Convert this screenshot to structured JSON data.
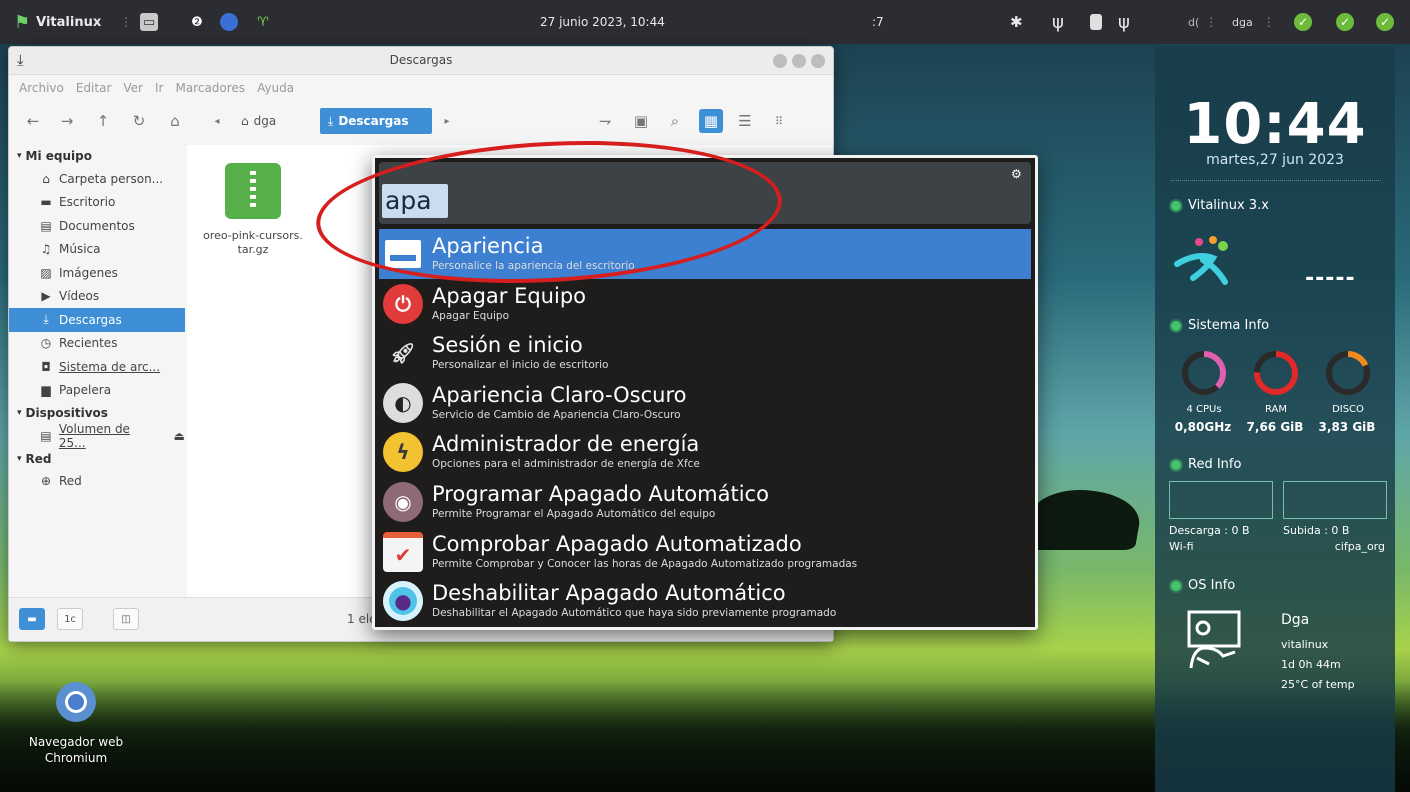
{
  "top_panel": {
    "app_name": "Vitalinux",
    "datetime": "27 junio 2023, 10:44",
    "workspace_hint": ":7",
    "user_label": "dga",
    "user_prefix": "d("
  },
  "file_manager": {
    "title": "Descargas",
    "menu": [
      "Archivo",
      "Editar",
      "Ver",
      "Ir",
      "Marcadores",
      "Ayuda"
    ],
    "breadcrumb": {
      "home": "dga",
      "current": "Descargas"
    },
    "sidebar": {
      "sections": [
        {
          "title": "Mi equipo",
          "items": [
            {
              "label": "Carpeta person...",
              "icon": "home-icon"
            },
            {
              "label": "Escritorio",
              "icon": "desktop-icon"
            },
            {
              "label": "Documentos",
              "icon": "document-icon"
            },
            {
              "label": "Música",
              "icon": "music-icon"
            },
            {
              "label": "Imágenes",
              "icon": "image-icon"
            },
            {
              "label": "Vídeos",
              "icon": "video-icon"
            },
            {
              "label": "Descargas",
              "icon": "download-icon",
              "selected": true
            },
            {
              "label": "Recientes",
              "icon": "clock-icon"
            },
            {
              "label": "Sistema de arc...",
              "icon": "drive-icon"
            },
            {
              "label": "Papelera",
              "icon": "trash-icon"
            }
          ]
        },
        {
          "title": "Dispositivos",
          "items": [
            {
              "label": "Volumen de 25...",
              "icon": "volume-icon"
            }
          ]
        },
        {
          "title": "Red",
          "items": [
            {
              "label": "Red",
              "icon": "network-icon"
            }
          ]
        }
      ]
    },
    "file": {
      "name": "oreo-pink-cursors.\ntar.gz"
    },
    "status_text": "1 ele"
  },
  "launcher": {
    "query": "apa",
    "results": [
      {
        "name": "Apariencia",
        "desc": "Personalice la apariencia del escritorio",
        "icon": "appearance-icon",
        "selected": true
      },
      {
        "name": "Apagar Equipo",
        "desc": "Apagar Equipo",
        "icon": "power-icon"
      },
      {
        "name": "Sesión e inicio",
        "desc": "Personalizar el inicio de escritorio",
        "icon": "rocket-icon"
      },
      {
        "name": "Apariencia Claro-Oscuro",
        "desc": "Servicio de Cambio de Apariencia Claro-Oscuro",
        "icon": "contrast-icon"
      },
      {
        "name": "Administrador de energía",
        "desc": "Opciones para el administrador de energía de Xfce",
        "icon": "energy-icon"
      },
      {
        "name": "Programar Apagado Automático",
        "desc": "Permite Programar el Apagado Automático del equipo",
        "icon": "shutdown-schedule-icon"
      },
      {
        "name": "Comprobar Apagado Automatizado",
        "desc": "Permite Comprobar y Conocer las horas de Apagado Automatizado programadas",
        "icon": "calendar-check-icon"
      },
      {
        "name": "Deshabilitar Apagado Automático",
        "desc": "Deshabilitar el Apagado Automático que haya sido previamente programado",
        "icon": "disable-target-icon"
      }
    ]
  },
  "conky": {
    "time": "10:44",
    "date": "martes,27 jun 2023",
    "distro": "Vitalinux 3.x",
    "dashes": "-----",
    "sistema_title": "Sistema Info",
    "cpu": {
      "label": "4 CPUs",
      "value": "0,80GHz"
    },
    "ram": {
      "label": "RAM",
      "value": "7,66 GiB"
    },
    "disk": {
      "label": "DISCO",
      "value": "3,83 GiB"
    },
    "red_title": "Red Info",
    "download": "Descarga : 0 B",
    "upload": "Subida : 0 B",
    "iface": "Wi-fi",
    "ssid": "cifpa_org",
    "os_title": "OS Info",
    "os_user": "Dga",
    "os_host": "vitalinux",
    "os_uptime": "1d 0h 44m",
    "os_temp": "25°C of temp"
  },
  "desktop": {
    "icon_label": "Navegador web Chromium"
  },
  "colors": {
    "accent": "#3d7fd1",
    "annotation": "#d61e1e",
    "status_ok": "#6dbb3a"
  }
}
